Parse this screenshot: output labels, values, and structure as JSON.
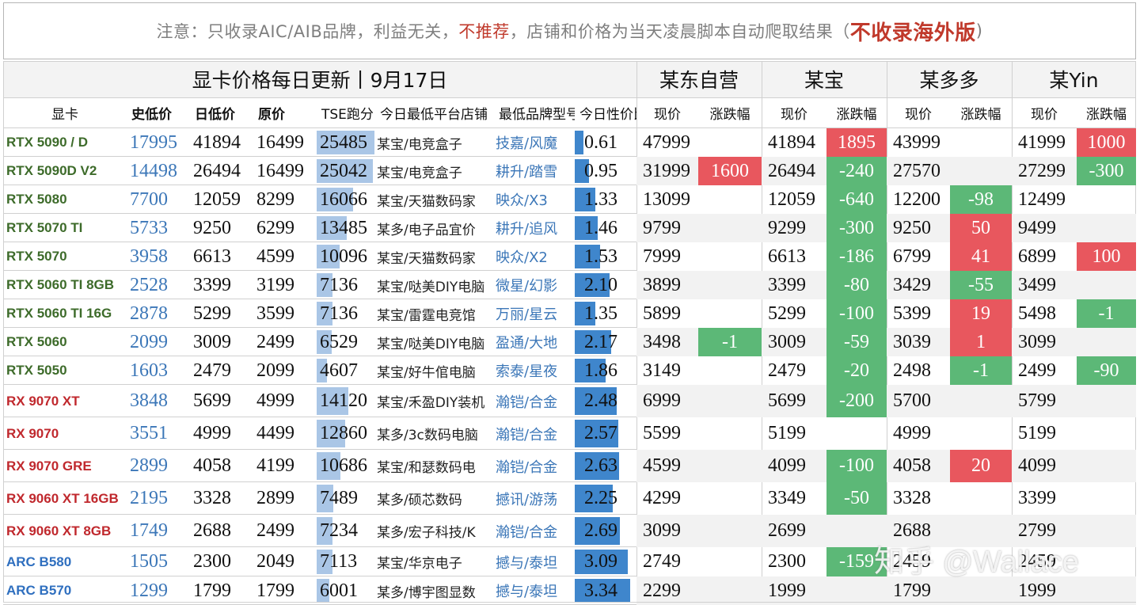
{
  "notice": {
    "part1": "注意：只收录AIC/AIB品牌，利益无关，",
    "part2": "不推荐",
    "part3": "，店铺和价格为当天凌晨脚本自动爬取结果（",
    "part4": "不收录海外版",
    "part5": ")"
  },
  "header": {
    "title": "显卡价格每日更新丨9月17日",
    "stores": [
      "某东自营",
      "某宝",
      "某多多",
      "某Yin"
    ],
    "cols": [
      "显卡",
      "史低价",
      "日低价",
      "原价",
      "TSE跑分",
      "今日最低平台店铺",
      "最低品牌型号",
      "今日性价比"
    ],
    "sub": [
      "现价",
      "涨跌幅"
    ]
  },
  "colors": {
    "nvidia": "#3d6b2a",
    "amd": "#c0282d",
    "intel": "#2f6fbf",
    "up": "#e8575e",
    "down": "#5cb877",
    "stripe": "#f2f2f2",
    "bar_light": "#aac6e6",
    "bar_dark": "#3f86cc"
  },
  "rows": [
    {
      "name": "RTX 5090 / D",
      "vendor": "nvidia",
      "hist": "17995",
      "day": "41894",
      "orig": "16499",
      "tse": "25485",
      "tse_pct": 0.98,
      "shop": "某宝/电竞盒子",
      "brand": "技嘉/风魔",
      "ratio": "0.61",
      "ratio_pct": 0.16,
      "jd": [
        "47999",
        ""
      ],
      "tb": [
        "41894",
        "1895"
      ],
      "pdd": [
        "43999",
        ""
      ],
      "yin": [
        "41999",
        "1000"
      ]
    },
    {
      "name": "RTX 5090D V2",
      "vendor": "nvidia",
      "hist": "14498",
      "day": "26494",
      "orig": "16499",
      "tse": "25042",
      "tse_pct": 0.96,
      "shop": "某宝/电竞盒子",
      "brand": "耕升/踏雪",
      "ratio": "0.95",
      "ratio_pct": 0.25,
      "jd": [
        "31999",
        "1600"
      ],
      "tb": [
        "26494",
        "-240"
      ],
      "pdd": [
        "27570",
        ""
      ],
      "yin": [
        "27299",
        "-300"
      ]
    },
    {
      "name": "RTX 5080",
      "vendor": "nvidia",
      "hist": "7700",
      "day": "12059",
      "orig": "8299",
      "tse": "16066",
      "tse_pct": 0.62,
      "shop": "某宝/天猫数码家",
      "brand": "映众/X3",
      "ratio": "1.33",
      "ratio_pct": 0.37,
      "jd": [
        "13099",
        ""
      ],
      "tb": [
        "12059",
        "-640"
      ],
      "pdd": [
        "12200",
        "-98"
      ],
      "yin": [
        "12499",
        ""
      ]
    },
    {
      "name": "RTX 5070 TI",
      "vendor": "nvidia",
      "hist": "5733",
      "day": "9250",
      "orig": "6299",
      "tse": "13485",
      "tse_pct": 0.52,
      "shop": "某多/电子品宜价",
      "brand": "耕升/追风",
      "ratio": "1.46",
      "ratio_pct": 0.42,
      "jd": [
        "9799",
        ""
      ],
      "tb": [
        "9299",
        "-300"
      ],
      "pdd": [
        "9250",
        "50"
      ],
      "yin": [
        "9499",
        ""
      ]
    },
    {
      "name": "RTX 5070",
      "vendor": "nvidia",
      "hist": "3958",
      "day": "6613",
      "orig": "4599",
      "tse": "10096",
      "tse_pct": 0.39,
      "shop": "某宝/天猫数码家",
      "brand": "映众/X2",
      "ratio": "1.53",
      "ratio_pct": 0.45,
      "jd": [
        "7999",
        ""
      ],
      "tb": [
        "6613",
        "-186"
      ],
      "pdd": [
        "6799",
        "41"
      ],
      "yin": [
        "6899",
        "100"
      ]
    },
    {
      "name": "RTX 5060 TI 8GB",
      "vendor": "nvidia",
      "hist": "2528",
      "day": "3399",
      "orig": "3199",
      "tse": "7136",
      "tse_pct": 0.27,
      "shop": "某宝/哒美DIY电脑",
      "brand": "微星/幻影",
      "ratio": "2.10",
      "ratio_pct": 0.63,
      "jd": [
        "3899",
        ""
      ],
      "tb": [
        "3399",
        "-80"
      ],
      "pdd": [
        "3429",
        "-55"
      ],
      "yin": [
        "3499",
        ""
      ]
    },
    {
      "name": "RTX 5060 TI 16G",
      "vendor": "nvidia",
      "hist": "2878",
      "day": "5299",
      "orig": "3599",
      "tse": "7136",
      "tse_pct": 0.27,
      "shop": "某宝/雷霆电竞馆",
      "brand": "万丽/星云",
      "ratio": "1.35",
      "ratio_pct": 0.37,
      "jd": [
        "5899",
        ""
      ],
      "tb": [
        "5299",
        "-100"
      ],
      "pdd": [
        "5399",
        "19"
      ],
      "yin": [
        "5498",
        "-1"
      ]
    },
    {
      "name": "RTX 5060",
      "vendor": "nvidia",
      "hist": "2099",
      "day": "3009",
      "orig": "2499",
      "tse": "6529",
      "tse_pct": 0.25,
      "shop": "某宝/哒美DIY电脑",
      "brand": "盈通/大地",
      "ratio": "2.17",
      "ratio_pct": 0.65,
      "jd": [
        "3498",
        "-1"
      ],
      "tb": [
        "3009",
        "-59"
      ],
      "pdd": [
        "3039",
        "1"
      ],
      "yin": [
        "3099",
        ""
      ]
    },
    {
      "name": "RTX 5050",
      "vendor": "nvidia",
      "hist": "1603",
      "day": "2479",
      "orig": "2099",
      "tse": "4607",
      "tse_pct": 0.17,
      "shop": "某宝/好牛倌电脑",
      "brand": "索泰/星夜",
      "ratio": "1.86",
      "ratio_pct": 0.55,
      "jd": [
        "3149",
        ""
      ],
      "tb": [
        "2479",
        "-20"
      ],
      "pdd": [
        "2498",
        "-1"
      ],
      "yin": [
        "2499",
        "-90"
      ]
    },
    {
      "name": "RX 9070 XT",
      "vendor": "amd",
      "hist": "3848",
      "day": "5699",
      "orig": "4999",
      "tse": "14120",
      "tse_pct": 0.54,
      "shop": "某宝/禾盈DIY装机",
      "brand": "瀚铠/合金",
      "ratio": "2.48",
      "ratio_pct": 0.75,
      "jd": [
        "6999",
        ""
      ],
      "tb": [
        "5699",
        "-200"
      ],
      "pdd": [
        "5700",
        ""
      ],
      "yin": [
        "5799",
        ""
      ]
    },
    {
      "name": "RX 9070",
      "vendor": "amd",
      "hist": "3551",
      "day": "4999",
      "orig": "4499",
      "tse": "12860",
      "tse_pct": 0.49,
      "shop": "某多/3c数码电脑",
      "brand": "瀚铠/合金",
      "ratio": "2.57",
      "ratio_pct": 0.78,
      "jd": [
        "5599",
        ""
      ],
      "tb": [
        "5199",
        ""
      ],
      "pdd": [
        "4999",
        ""
      ],
      "yin": [
        "5199",
        ""
      ]
    },
    {
      "name": "RX 9070 GRE",
      "vendor": "amd",
      "hist": "2899",
      "day": "4058",
      "orig": "4199",
      "tse": "10686",
      "tse_pct": 0.41,
      "shop": "某宝/和瑟数码电",
      "brand": "瀚铠/合金",
      "ratio": "2.63",
      "ratio_pct": 0.8,
      "jd": [
        "4599",
        ""
      ],
      "tb": [
        "4099",
        "-100"
      ],
      "pdd": [
        "4058",
        "20"
      ],
      "yin": [
        "4099",
        ""
      ]
    },
    {
      "name": "RX 9060 XT 16GB",
      "vendor": "amd",
      "hist": "2195",
      "day": "3328",
      "orig": "2899",
      "tse": "7489",
      "tse_pct": 0.28,
      "shop": "某多/硕芯数码",
      "brand": "撼讯/游荡",
      "ratio": "2.25",
      "ratio_pct": 0.68,
      "jd": [
        "4299",
        ""
      ],
      "tb": [
        "3349",
        "-50"
      ],
      "pdd": [
        "3328",
        ""
      ],
      "yin": [
        "3399",
        ""
      ]
    },
    {
      "name": "RX 9060 XT 8GB",
      "vendor": "amd",
      "hist": "1749",
      "day": "2688",
      "orig": "2499",
      "tse": "7234",
      "tse_pct": 0.27,
      "shop": "某多/宏子科技/K",
      "brand": "瀚铠/合金",
      "ratio": "2.69",
      "ratio_pct": 0.82,
      "jd": [
        "3099",
        ""
      ],
      "tb": [
        "2699",
        ""
      ],
      "pdd": [
        "2688",
        ""
      ],
      "yin": [
        "2799",
        ""
      ]
    },
    {
      "name": "ARC B580",
      "vendor": "intel",
      "hist": "1505",
      "day": "2300",
      "orig": "2049",
      "tse": "7113",
      "tse_pct": 0.27,
      "shop": "某宝/华京电子",
      "brand": "撼与/泰坦",
      "ratio": "3.09",
      "ratio_pct": 0.95,
      "jd": [
        "2749",
        ""
      ],
      "tb": [
        "2300",
        "-159"
      ],
      "pdd": [
        "2459",
        ""
      ],
      "yin": [
        "2459",
        ""
      ]
    },
    {
      "name": "ARC B570",
      "vendor": "intel",
      "hist": "1299",
      "day": "1799",
      "orig": "1799",
      "tse": "6001",
      "tse_pct": 0.22,
      "shop": "某多/博宇图显数",
      "brand": "撼与/泰坦",
      "ratio": "3.34",
      "ratio_pct": 1.0,
      "jd": [
        "2299",
        ""
      ],
      "tb": [
        "1999",
        ""
      ],
      "pdd": [
        "1799",
        ""
      ],
      "yin": [
        "1999",
        ""
      ]
    }
  ],
  "watermark": "知乎 @Wallace"
}
